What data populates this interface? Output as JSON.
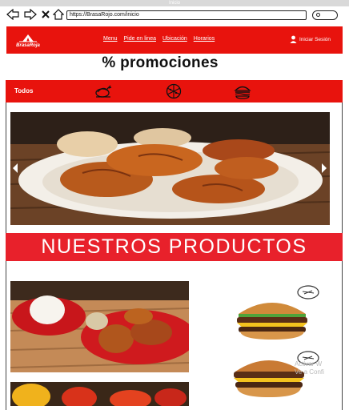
{
  "window": {
    "title": "Inicio"
  },
  "browser": {
    "url": "https://BrasaRojo.com/inicio"
  },
  "site": {
    "logo_text": "BrasaRoja",
    "menu": [
      "Menu",
      "Pide en linea",
      "Ubicación",
      "Horarios"
    ],
    "login_label": "Iniciar Sesión"
  },
  "promo": {
    "title": "% promociones"
  },
  "categories": {
    "all_label": "Todos",
    "icons": [
      "chicken-icon",
      "pizza-icon",
      "burger-icon"
    ]
  },
  "products": {
    "banner_title": "NUESTROS PRODUCTOS"
  },
  "watermark": {
    "line1": "Activar W",
    "line2": "Ve a Confi"
  },
  "colors": {
    "brand_red": "#e8130d",
    "banner_red": "#e8212b"
  }
}
